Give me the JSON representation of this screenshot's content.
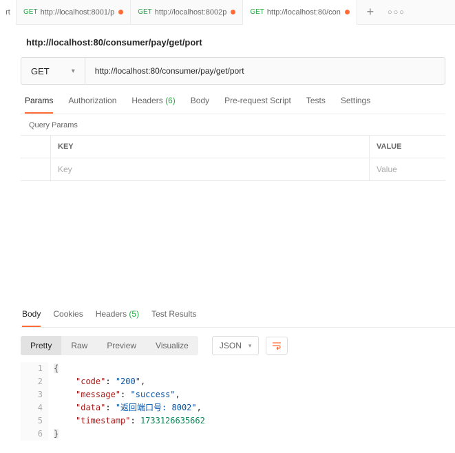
{
  "topbar": {
    "left_stub": "rt",
    "tabs": [
      {
        "method": "GET",
        "label": "http://localhost:8001/p",
        "dirty": true,
        "active": false
      },
      {
        "method": "GET",
        "label": "http://localhost:8002p",
        "dirty": true,
        "active": false
      },
      {
        "method": "GET",
        "label": "http://localhost:80/con",
        "dirty": true,
        "active": true
      }
    ]
  },
  "title": "http://localhost:80/consumer/pay/get/port",
  "request": {
    "method": "GET",
    "url": "http://localhost:80/consumer/pay/get/port",
    "tabs": {
      "params": "Params",
      "auth": "Authorization",
      "headers": "Headers",
      "headers_count": "(6)",
      "body": "Body",
      "prerequest": "Pre-request Script",
      "tests": "Tests",
      "settings": "Settings"
    },
    "query_params_header": "Query Params",
    "table": {
      "key_header": "KEY",
      "value_header": "VALUE",
      "key_placeholder": "Key",
      "value_placeholder": "Value"
    }
  },
  "response": {
    "tabs": {
      "body": "Body",
      "cookies": "Cookies",
      "headers": "Headers",
      "headers_count": "(5)",
      "test_results": "Test Results"
    },
    "view": {
      "pretty": "Pretty",
      "raw": "Raw",
      "preview": "Preview",
      "visualize": "Visualize",
      "format": "JSON"
    },
    "body_json": {
      "code": "200",
      "message": "success",
      "data": "返回端口号: 8002",
      "timestamp": 1733126635662
    }
  }
}
